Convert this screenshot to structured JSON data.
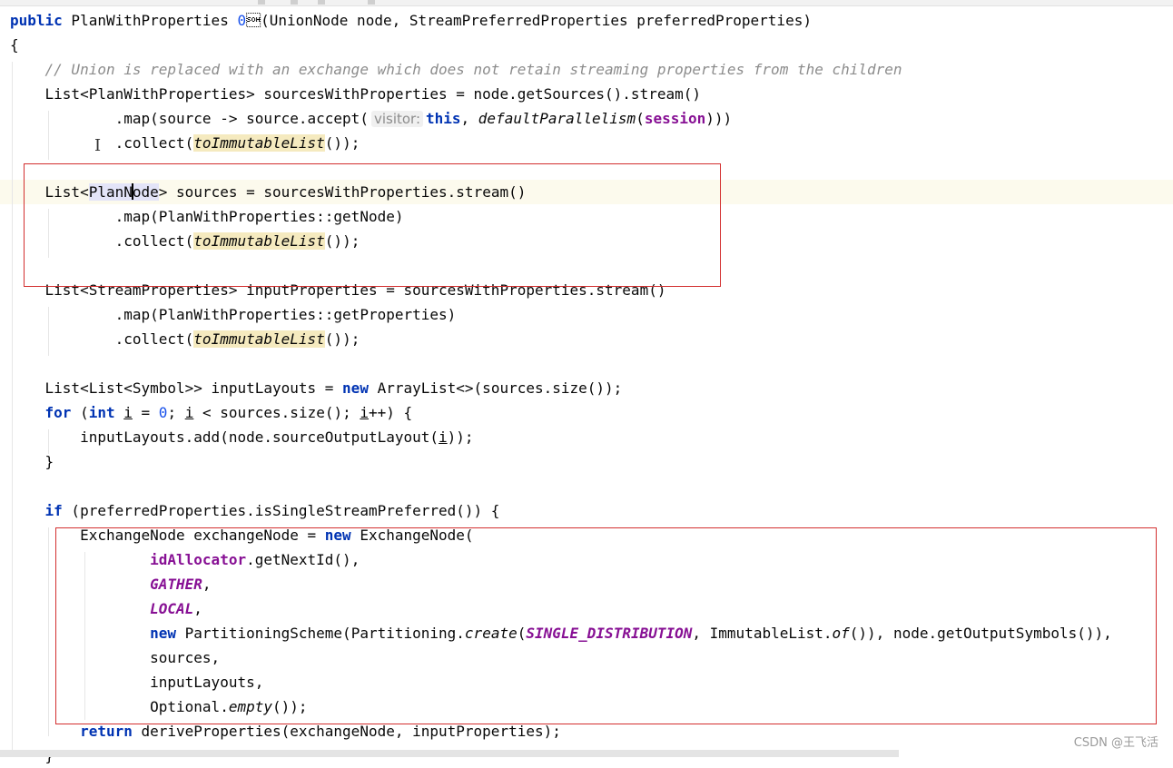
{
  "editor": {
    "lines": [
      "public PlanWithProperties visitUnion(UnionNode node, StreamPreferredProperties preferredProperties)",
      "{",
      "    // Union is replaced with an exchange which does not retain streaming properties from the children",
      "    List<PlanWithProperties> sourcesWithProperties = node.getSources().stream()",
      "            .map(source -> source.accept( visitor: this, defaultParallelism(session)))",
      "            .collect(toImmutableList());",
      "",
      "    List<PlanNode> sources = sourcesWithProperties.stream()",
      "            .map(PlanWithProperties::getNode)",
      "            .collect(toImmutableList());",
      "",
      "    List<StreamProperties> inputProperties = sourcesWithProperties.stream()",
      "            .map(PlanWithProperties::getProperties)",
      "            .collect(toImmutableList());",
      "",
      "    List<List<Symbol>> inputLayouts = new ArrayList<>(sources.size());",
      "    for (int i = 0; i < sources.size(); i++) {",
      "        inputLayouts.add(node.sourceOutputLayout(i));",
      "    }",
      "",
      "    if (preferredProperties.isSingleStreamPreferred()) {",
      "        ExchangeNode exchangeNode = new ExchangeNode(",
      "                idAllocator.getNextId(),",
      "                GATHER,",
      "                LOCAL,",
      "                new PartitioningScheme(Partitioning.create(SINGLE_DISTRIBUTION, ImmutableList.of()), node.getOutputSymbols()),",
      "                sources,",
      "                inputLayouts,",
      "                Optional.empty());",
      "        return deriveProperties(exchangeNode, inputProperties);",
      "    }"
    ]
  },
  "watermark": "CSDN @王飞活",
  "colors": {
    "keyword": "#0033b3",
    "comment": "#8c8c8c",
    "static_field": "#871094",
    "number": "#1750eb",
    "search_highlight": "#ffff00",
    "annotation_box": "#d32f2f"
  }
}
